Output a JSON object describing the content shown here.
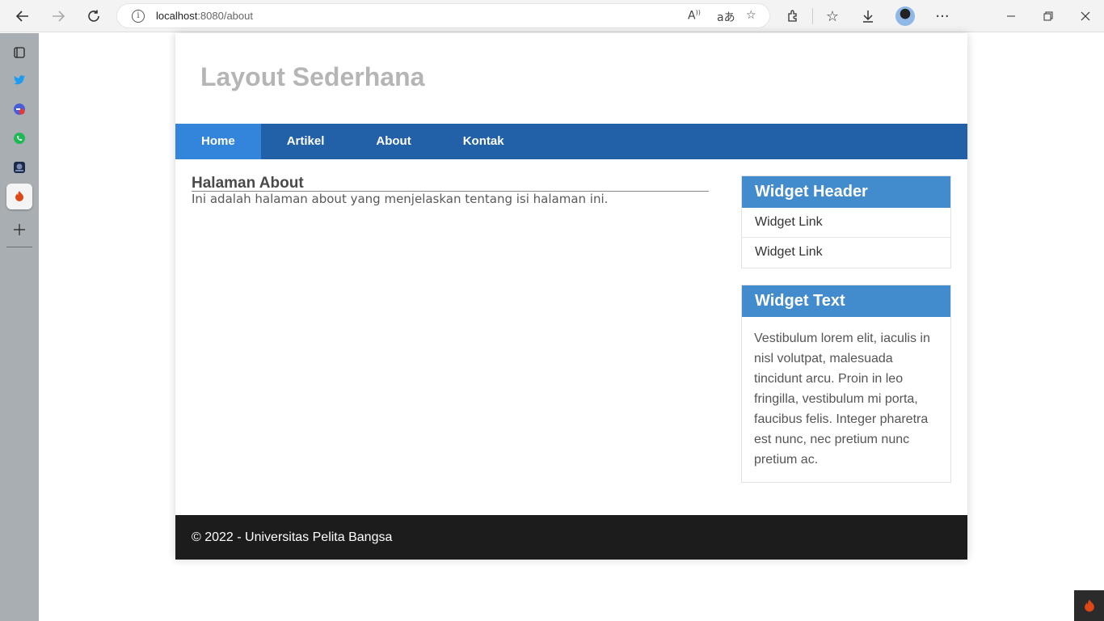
{
  "browser": {
    "url_host": "localhost",
    "url_rest": ":8080/about",
    "icons": [
      "back-arrow",
      "forward-arrow",
      "reload",
      "info",
      "read-aloud",
      "translate",
      "favorite-add",
      "extensions",
      "favorites",
      "downloads",
      "profile",
      "more"
    ],
    "window_icons": [
      "minimize",
      "restore",
      "close"
    ]
  },
  "sidebar": {
    "icons": [
      "tab-actions",
      "twitter",
      "google-games",
      "whatsapp",
      "app-dark",
      "codeigniter-active",
      "add"
    ]
  },
  "page": {
    "site_title": "Layout Sederhana",
    "nav": [
      {
        "label": "Home",
        "active": true
      },
      {
        "label": "Artikel",
        "active": false
      },
      {
        "label": "About",
        "active": false
      },
      {
        "label": "Kontak",
        "active": false
      }
    ],
    "content": {
      "heading": "Halaman About",
      "body": "Ini adalah halaman about yang menjelaskan tentang isi halaman ini."
    },
    "widgets": {
      "links": {
        "header": "Widget Header",
        "items": [
          "Widget Link",
          "Widget Link"
        ]
      },
      "text": {
        "header": "Widget Text",
        "body": "Vestibulum lorem elit, iaculis in nisl volutpat, malesuada tincidunt arcu. Proin in leo fringilla, vestibulum mi porta, faucibus felis. Integer pharetra est nunc, nec pretium nunc pretium ac."
      }
    },
    "footer": "© 2022 - Universitas Pelita Bangsa"
  },
  "colors": {
    "nav_bg": "#2261a8",
    "nav_active": "#3384db",
    "widget_header": "#428bcd",
    "footer_bg": "#1c1c1c",
    "title": "#b5b5b5"
  }
}
